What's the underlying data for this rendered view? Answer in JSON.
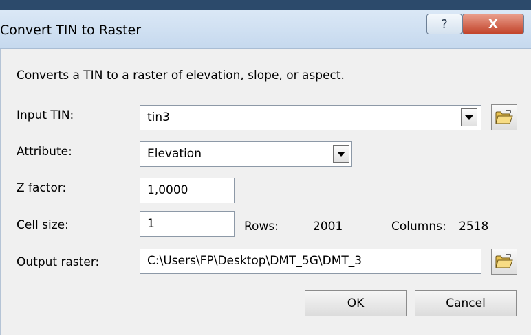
{
  "window": {
    "title": "Convert TIN to Raster",
    "help_symbol": "?",
    "close_symbol": "X"
  },
  "description": "Converts a TIN to a raster of elevation, slope, or aspect.",
  "form": {
    "input_tin": {
      "label": "Input TIN:",
      "value": "tin3"
    },
    "attribute": {
      "label": "Attribute:",
      "value": "Elevation"
    },
    "z_factor": {
      "label": "Z factor:",
      "value": "1,0000"
    },
    "cell_size": {
      "label": "Cell size:",
      "value": "1",
      "rows_label": "Rows:",
      "rows_value": "2001",
      "columns_label": "Columns:",
      "columns_value": "2518"
    },
    "output_raster": {
      "label": "Output raster:",
      "value": "C:\\Users\\FP\\Desktop\\DMT_5G\\DMT_3"
    }
  },
  "buttons": {
    "ok": "OK",
    "cancel": "Cancel"
  },
  "icons": {
    "browse": "folder-open-icon",
    "dropdown": "chevron-down-icon"
  },
  "colors": {
    "title_bar": "#c9dcf0",
    "close_button": "#c94c35",
    "dialog_bg": "#f0f0f0"
  }
}
